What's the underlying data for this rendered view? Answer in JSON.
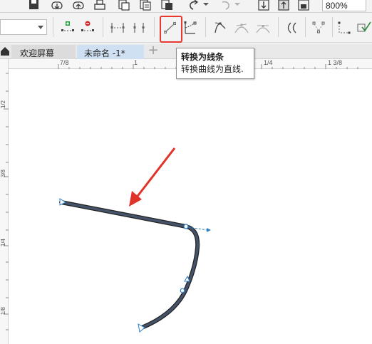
{
  "toolbar": {
    "zoom_value": "800%"
  },
  "tabs": [
    {
      "label": "欢迎屏幕",
      "active": false
    },
    {
      "label": "未命名 -1*",
      "active": true
    }
  ],
  "tab_add_label": "+",
  "ruler": {
    "h_ticks": [
      "7/8",
      "1",
      "1/4",
      "1 3/8"
    ],
    "v_ticks": [
      "1/2",
      "3/8",
      "1/4",
      "1/8"
    ]
  },
  "tooltip": {
    "title": "转换为线条",
    "description": "转换曲线为直线."
  },
  "colors": {
    "highlight_box": "#e8372c",
    "arrow": "#e0332a",
    "curve_fill": "#45536a",
    "node_color": "#2f7fc4",
    "tab_active_bg": "#cfe0f2"
  },
  "icons": {
    "add_node": "add-node-icon",
    "delete_node": "delete-node-icon",
    "convert_to_line": "convert-to-line-icon",
    "convert_to_curve": "convert-to-curve-icon",
    "home": "home-icon"
  }
}
